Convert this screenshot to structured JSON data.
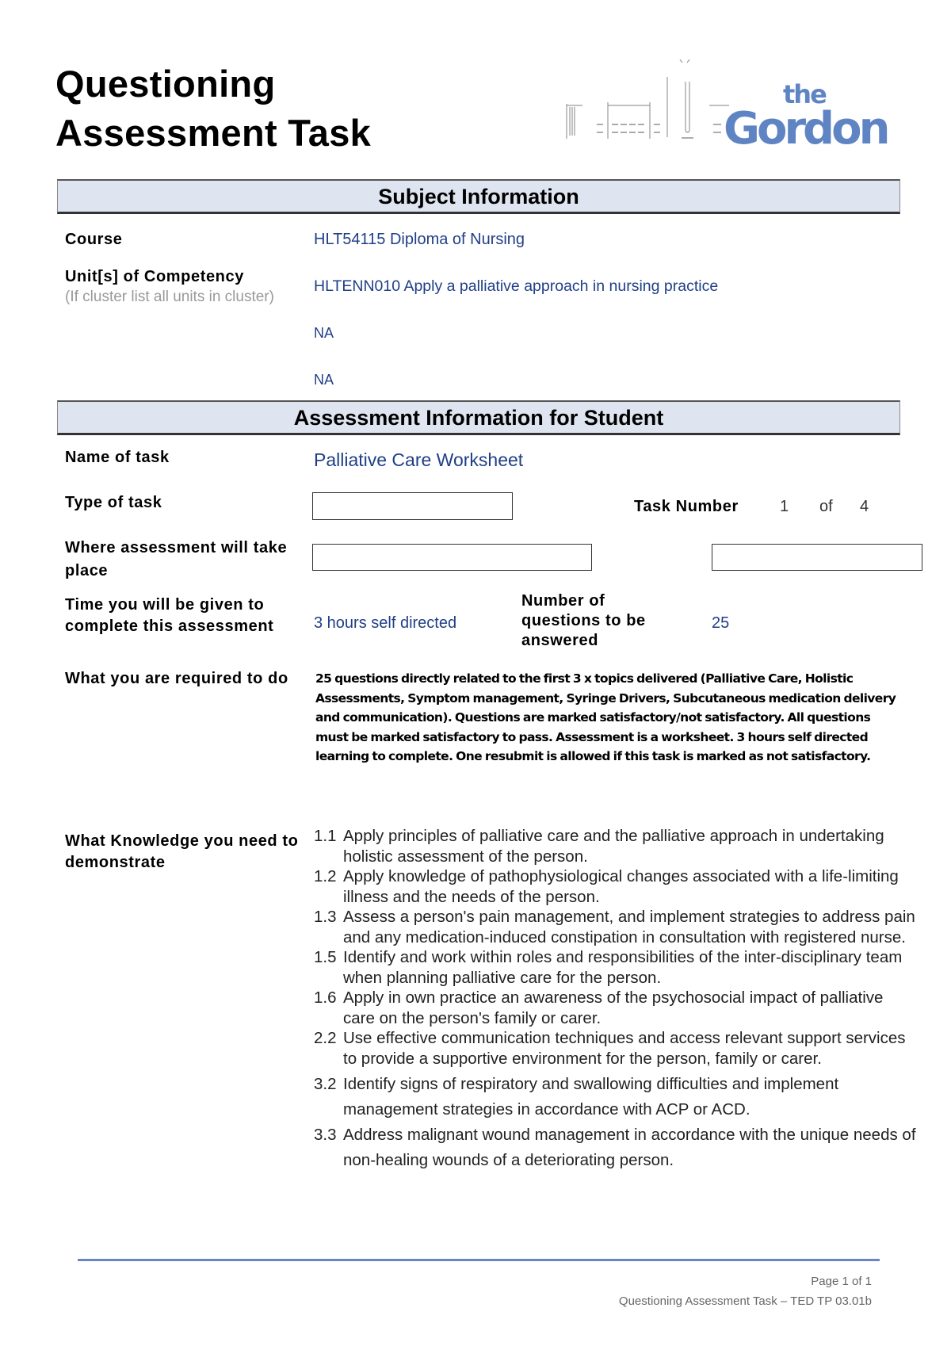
{
  "header": {
    "title_line1": "Questioning",
    "title_line2": "Assessment Task",
    "logo": {
      "small_word": "the",
      "big_word": "Gordon",
      "brand_color": "#5f84c4"
    }
  },
  "subject_info": {
    "heading": "Subject Information",
    "course_label": "Course",
    "course_value": "HLT54115 Diploma of Nursing",
    "units_label": "Unit[s] of Competency",
    "units_sublabel": "(If cluster list all units in cluster)",
    "units": [
      "HLTENN010 Apply a palliative approach in nursing practice",
      "NA",
      "NA"
    ]
  },
  "assessment_info": {
    "heading": "Assessment Information for Student",
    "name_label": "Name of task",
    "name_value": "Palliative Care Worksheet",
    "type_label": "Type of task",
    "type_value": "",
    "task_number_label": "Task Number",
    "task_number": "1",
    "task_of": "of",
    "task_total": "4",
    "where_label": "Where assessment will take place",
    "where_value": "",
    "where_value_2": "",
    "time_label": "Time you will be given to complete this assessment",
    "time_value": "3 hours self directed",
    "num_questions_label": "Number of questions to be answered",
    "num_questions_value": "25",
    "required_label": "What you are required to do",
    "required_text": "25 questions directly related to the first 3 x topics delivered (Palliative Care, Holistic Assessments, Symptom management, Syringe Drivers, Subcutaneous medication delivery and communication).  Questions are marked satisfactory/not satisfactory.  All questions must be marked satisfactory to pass. Assessment is a worksheet.  3 hours self directed learning to complete.  One resubmit is allowed if this task is marked as not satisfactory.",
    "knowledge_label": "What Knowledge you need to demonstrate",
    "knowledge_items": [
      {
        "num": "1.1",
        "text": "Apply principles of palliative care and the palliative approach in undertaking holistic assessment of the person."
      },
      {
        "num": "1.2",
        "text": "Apply knowledge of pathophysiological changes associated with a life-limiting illness and the needs of the person."
      },
      {
        "num": "1.3",
        "text": "Assess a person's pain management, and implement strategies to address pain and any medication-induced constipation in consultation with registered nurse."
      },
      {
        "num": "1.5",
        "text": "Identify and work within roles and responsibilities of the inter-disciplinary team when planning palliative care for the person."
      },
      {
        "num": "1.6",
        "text": "Apply in own practice an awareness of the psychosocial impact of palliative care on the person's family or carer."
      },
      {
        "num": "2.2",
        "text": "Use effective communication techniques and access relevant support services to provide a supportive environment for the person, family or carer."
      },
      {
        "num": "3.2",
        "text": "Identify signs of respiratory and swallowing difficulties and implement management strategies in accordance with ACP or ACD."
      },
      {
        "num": "3.3",
        "text": "Address malignant wound management in accordance with the unique needs of non-healing wounds of a deteriorating person."
      }
    ]
  },
  "footer": {
    "page": "Page 1 of 1",
    "doc_ref": "Questioning Assessment Task – TED TP 03.01b"
  }
}
